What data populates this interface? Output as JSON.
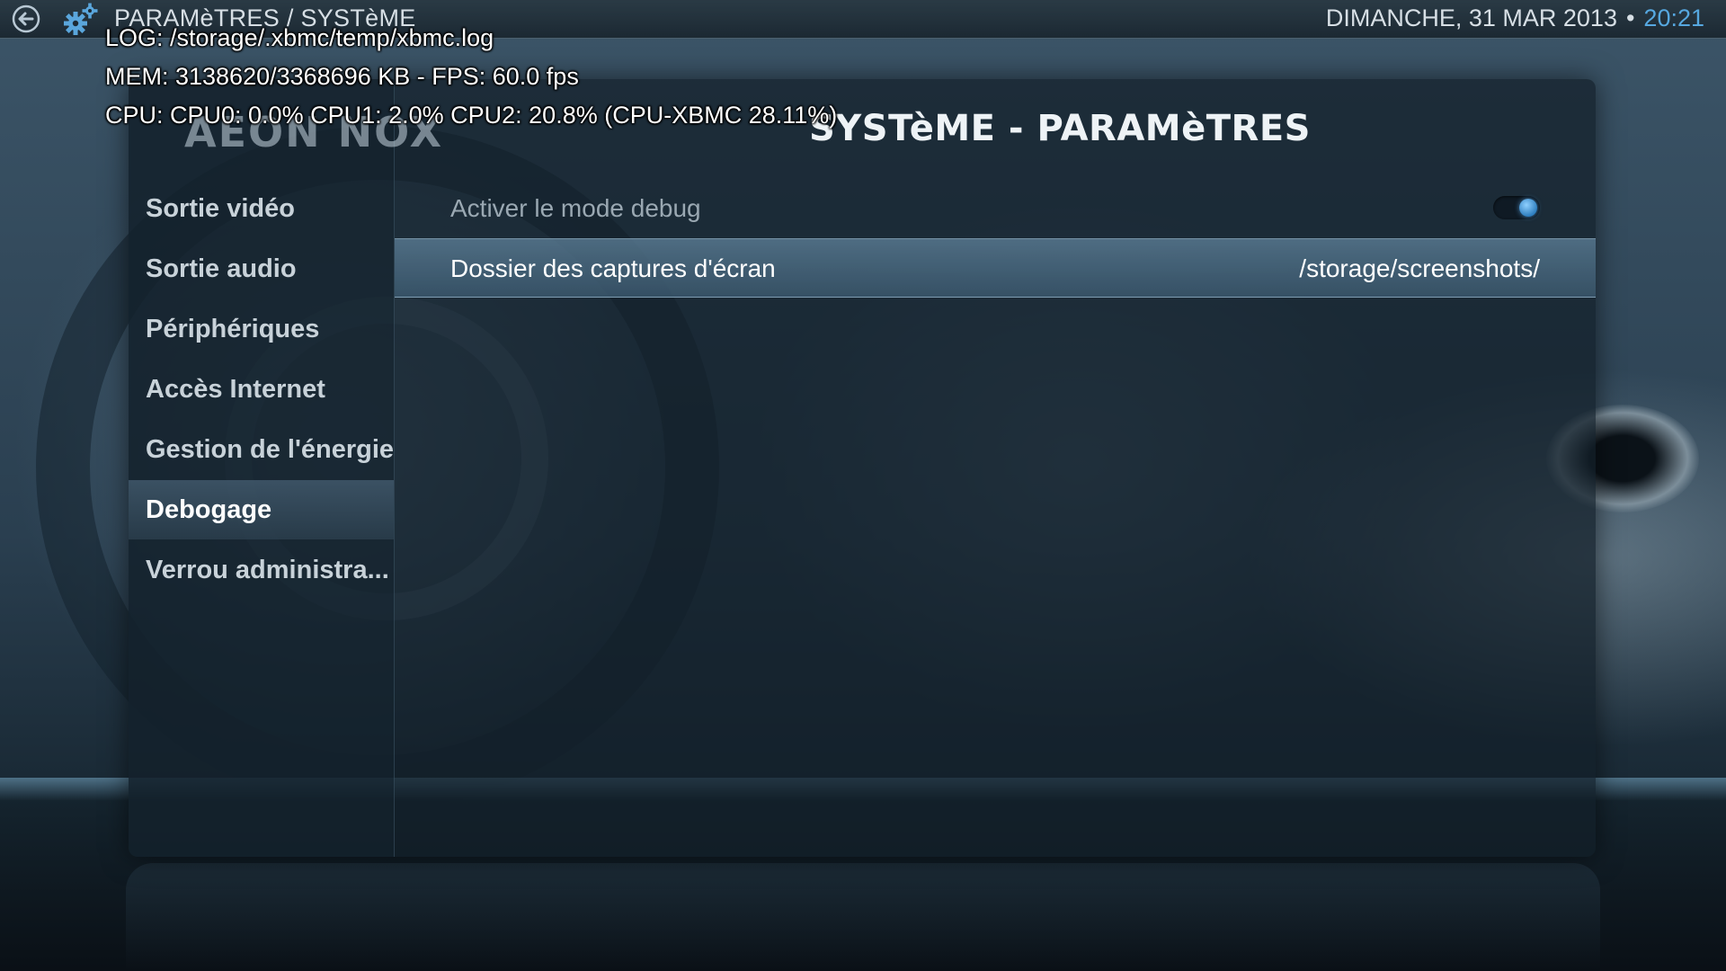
{
  "header": {
    "breadcrumb": "PARAMèTRES / SYSTèME",
    "date": "DIMANCHE, 31 MAR 2013",
    "separator": "•",
    "time": "20:21",
    "back_icon": "back-arrow-icon",
    "settings_icon": "gear-icon",
    "time_color": "#56a8e0"
  },
  "debug_overlay": {
    "log": "LOG: /storage/.xbmc/temp/xbmc.log",
    "mem": "MEM: 3138620/3368696 KB - FPS: 60.0 fps",
    "cpu": "CPU: CPU0: 0.0% CPU1: 2.0% CPU2: 20.8%  (CPU-XBMC 28.11%)"
  },
  "panel": {
    "logo": "AEON NOX",
    "title": "SYSTèME - PARAMèTRES"
  },
  "sidebar": {
    "items": [
      {
        "label": "Sortie vidéo"
      },
      {
        "label": "Sortie audio"
      },
      {
        "label": "Périphériques"
      },
      {
        "label": "Accès Internet"
      },
      {
        "label": "Gestion de l'énergie"
      },
      {
        "label": "Debogage"
      },
      {
        "label": "Verrou administra..."
      }
    ],
    "selected": "Debogage"
  },
  "settings": {
    "debug_mode": {
      "label": "Activer le mode debug",
      "enabled": true
    },
    "screenshots": {
      "label": "Dossier des captures d'écran",
      "value": "/storage/screenshots/"
    }
  }
}
